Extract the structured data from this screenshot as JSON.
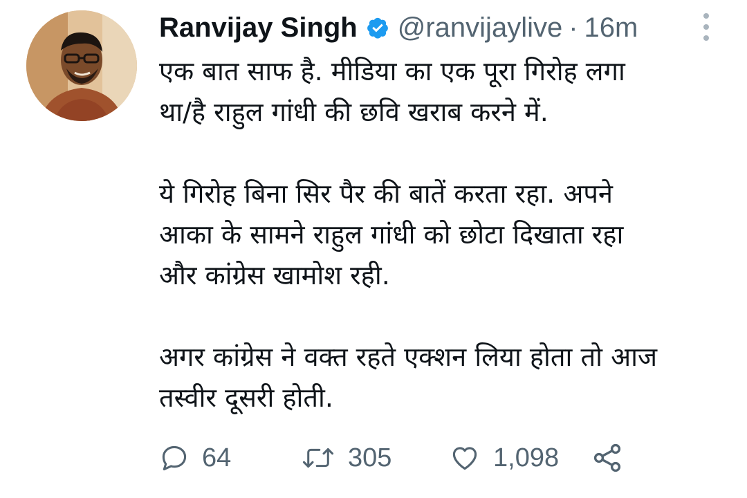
{
  "author": {
    "name": "Ranvijay Singh",
    "handle": "@ranvijaylive",
    "separator": "·",
    "time": "16m",
    "verified": true
  },
  "tweet": {
    "paragraphs": [
      "एक बात साफ है. मीडिया का एक पूरा गिरोह लगा\nथा/है राहुल गांधी की छवि खराब करने में.",
      "ये गिरोह बिना सिर पैर की बातें करता रहा. अपने\nआका के सामने राहुल गांधी को छोटा दिखाता रहा\nऔर कांग्रेस खामोश रही.",
      "अगर कांग्रेस ने वक्त रहते एक्शन लिया होता तो आज\nतस्वीर दूसरी होती."
    ]
  },
  "actions": {
    "replies": "64",
    "retweets": "305",
    "likes": "1,098"
  },
  "colors": {
    "text": "#0f1419",
    "secondary": "#536471",
    "verified": "#1d9bf0",
    "background": "#ffffff"
  },
  "icons": [
    "verified-badge-icon",
    "more-options-icon",
    "reply-icon",
    "retweet-icon",
    "like-icon",
    "share-icon"
  ]
}
